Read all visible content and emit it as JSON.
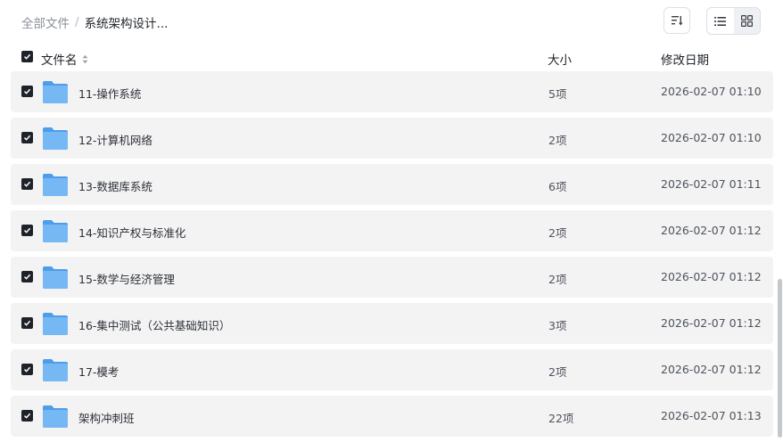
{
  "breadcrumb": {
    "root": "全部文件",
    "separator": "/",
    "current": "系统架构设计..."
  },
  "toolbar": {
    "sort_icon": "sort-list-icon",
    "view_list_icon": "list-view-icon",
    "view_grid_icon": "grid-view-icon",
    "active_view": "list"
  },
  "header": {
    "name": "文件名",
    "size": "大小",
    "date": "修改日期",
    "all_checked": true
  },
  "files": [
    {
      "name": "11-操作系统",
      "size": "5项",
      "date": "2026-02-07 01:10",
      "checked": true
    },
    {
      "name": "12-计算机网络",
      "size": "2项",
      "date": "2026-02-07 01:10",
      "checked": true
    },
    {
      "name": "13-数据库系统",
      "size": "6项",
      "date": "2026-02-07 01:11",
      "checked": true
    },
    {
      "name": "14-知识产权与标准化",
      "size": "2项",
      "date": "2026-02-07 01:12",
      "checked": true
    },
    {
      "name": "15-数学与经济管理",
      "size": "2项",
      "date": "2026-02-07 01:12",
      "checked": true
    },
    {
      "name": "16-集中测试（公共基础知识）",
      "size": "3项",
      "date": "2026-02-07 01:12",
      "checked": true
    },
    {
      "name": "17-模考",
      "size": "2项",
      "date": "2026-02-07 01:12",
      "checked": true
    },
    {
      "name": "架构冲刺班",
      "size": "22项",
      "date": "2026-02-07 01:13",
      "checked": true
    }
  ],
  "colors": {
    "row_bg": "#f3f3f4",
    "folder": "#5aa8f0",
    "checkbox": "#1f2329"
  }
}
